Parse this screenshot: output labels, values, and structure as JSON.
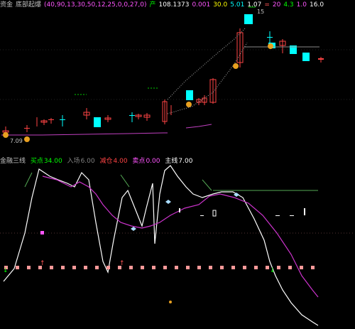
{
  "upper": {
    "title": "资金",
    "indicator_label": "底部起爆",
    "params_text": "(40,90,13,30,50,12,25,0,0,27,0)",
    "val1": "产",
    "val2": "108.1373",
    "val3": "0.001",
    "val4": "30.0",
    "val5": "5.01",
    "val6": "1.07",
    "val7": "=",
    "val8": "20",
    "val9": "4.3",
    "val10": "1.0",
    "val11": "16.0",
    "high_label": "15",
    "low_label": "7.09",
    "colors": {
      "title": "#c0c0c0",
      "params": "#ff55ff",
      "val": "#ffff00",
      "accent": "#00ffff"
    }
  },
  "lower": {
    "title": "金融三线",
    "field1_label": "买点",
    "field1_value": "34.00",
    "field2_label": "入场",
    "field2_value": "6.00",
    "field3_label": "减仓",
    "field3_value": "4.00",
    "field4_label": "卖点",
    "field4_value": "0.00",
    "field5_label": "主线",
    "field5_value": "7.00"
  }
}
